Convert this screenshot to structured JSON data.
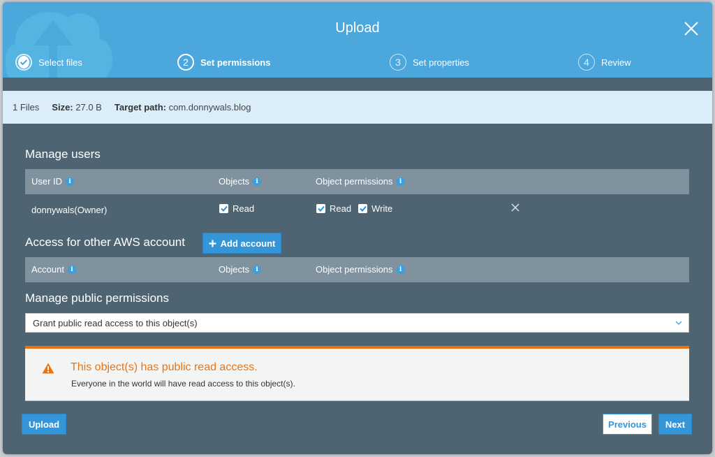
{
  "dialog": {
    "title": "Upload",
    "close_icon": "close-icon"
  },
  "steps": [
    {
      "number": "1",
      "label": "Select files",
      "state": "completed"
    },
    {
      "number": "2",
      "label": "Set permissions",
      "state": "active"
    },
    {
      "number": "3",
      "label": "Set properties",
      "state": "pending"
    },
    {
      "number": "4",
      "label": "Review",
      "state": "pending"
    }
  ],
  "summary": {
    "files": "1 Files",
    "size_label": "Size:",
    "size_value": "27.0 B",
    "target_label": "Target path:",
    "target_value": "com.donnywals.blog"
  },
  "manage_users": {
    "title": "Manage users",
    "columns": [
      "User ID",
      "Objects",
      "Object permissions"
    ],
    "rows": [
      {
        "user_id": "donnywals(Owner)",
        "objects": [
          {
            "label": "Read",
            "checked": true
          }
        ],
        "object_permissions": [
          {
            "label": "Read",
            "checked": true
          },
          {
            "label": "Write",
            "checked": true
          }
        ]
      }
    ]
  },
  "other_accounts": {
    "title": "Access for other AWS account",
    "add_button": "Add account",
    "columns": [
      "Account",
      "Objects",
      "Object permissions"
    ]
  },
  "public_permissions": {
    "title": "Manage public permissions",
    "selected": "Grant public read access to this object(s)"
  },
  "alert": {
    "title": "This object(s) has public read access.",
    "body": "Everyone in the world will have read access to this object(s).",
    "color": "#ec7211"
  },
  "footer": {
    "upload": "Upload",
    "previous": "Previous",
    "next": "Next"
  },
  "colors": {
    "header": "#4ca7dc",
    "body": "#4f6472",
    "primary": "#3496d8"
  }
}
